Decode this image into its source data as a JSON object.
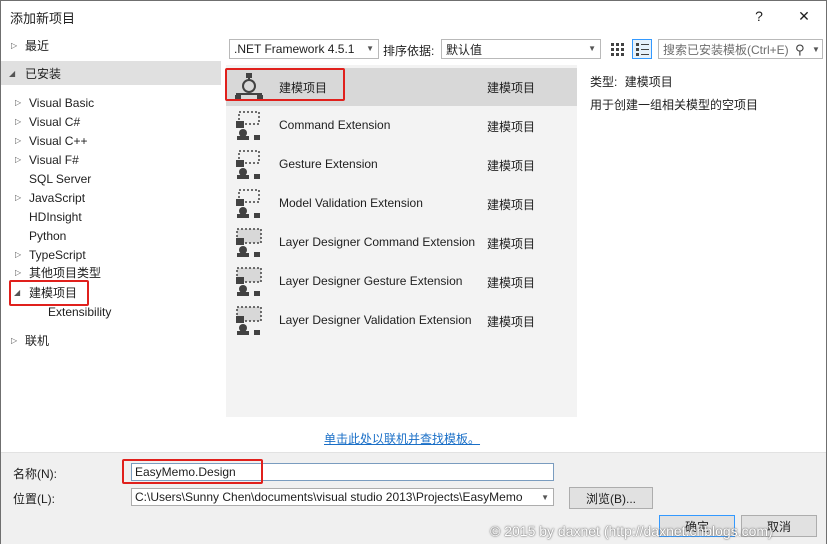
{
  "window": {
    "title": "添加新项目",
    "help": "?",
    "close": "✕"
  },
  "tree": {
    "recent": "最近",
    "installed": "已安装",
    "items": [
      "Visual Basic",
      "Visual C#",
      "Visual C++",
      "Visual F#",
      "SQL Server",
      "JavaScript",
      "HDInsight",
      "Python",
      "TypeScript",
      "其他项目类型",
      "建模项目"
    ],
    "extensibility": "Extensibility",
    "online": "联机"
  },
  "toolbar": {
    "framework": ".NET Framework 4.5.1",
    "sort_label": "排序依据:",
    "sort_value": "默认值",
    "search_placeholder": "搜索已安装模板(Ctrl+E)"
  },
  "templates": [
    {
      "name": "建模项目",
      "type": "建模项目"
    },
    {
      "name": "Command Extension",
      "type": "建模项目"
    },
    {
      "name": "Gesture Extension",
      "type": "建模项目"
    },
    {
      "name": "Model Validation Extension",
      "type": "建模项目"
    },
    {
      "name": "Layer Designer Command Extension",
      "type": "建模项目"
    },
    {
      "name": "Layer Designer Gesture Extension",
      "type": "建模项目"
    },
    {
      "name": "Layer Designer Validation Extension",
      "type": "建模项目"
    }
  ],
  "info": {
    "type_label": "类型:",
    "type_value": "建模项目",
    "description": "用于创建一组相关模型的空项目"
  },
  "online_link": "单击此处以联机并查找模板。",
  "form": {
    "name_label": "名称(N):",
    "name_value": "EasyMemo.Design",
    "location_label": "位置(L):",
    "location_value": "C:\\Users\\Sunny Chen\\documents\\visual studio 2013\\Projects\\EasyMemo",
    "browse": "浏览(B)...",
    "ok": "确定",
    "cancel": "取消"
  },
  "watermark": "© 2015 by daxnet (http://daxnet.cnblogs.com)",
  "colors": {
    "highlight_red": "#e0201c",
    "link_blue": "#1a6fc7",
    "selection": "#d8d8d8"
  }
}
